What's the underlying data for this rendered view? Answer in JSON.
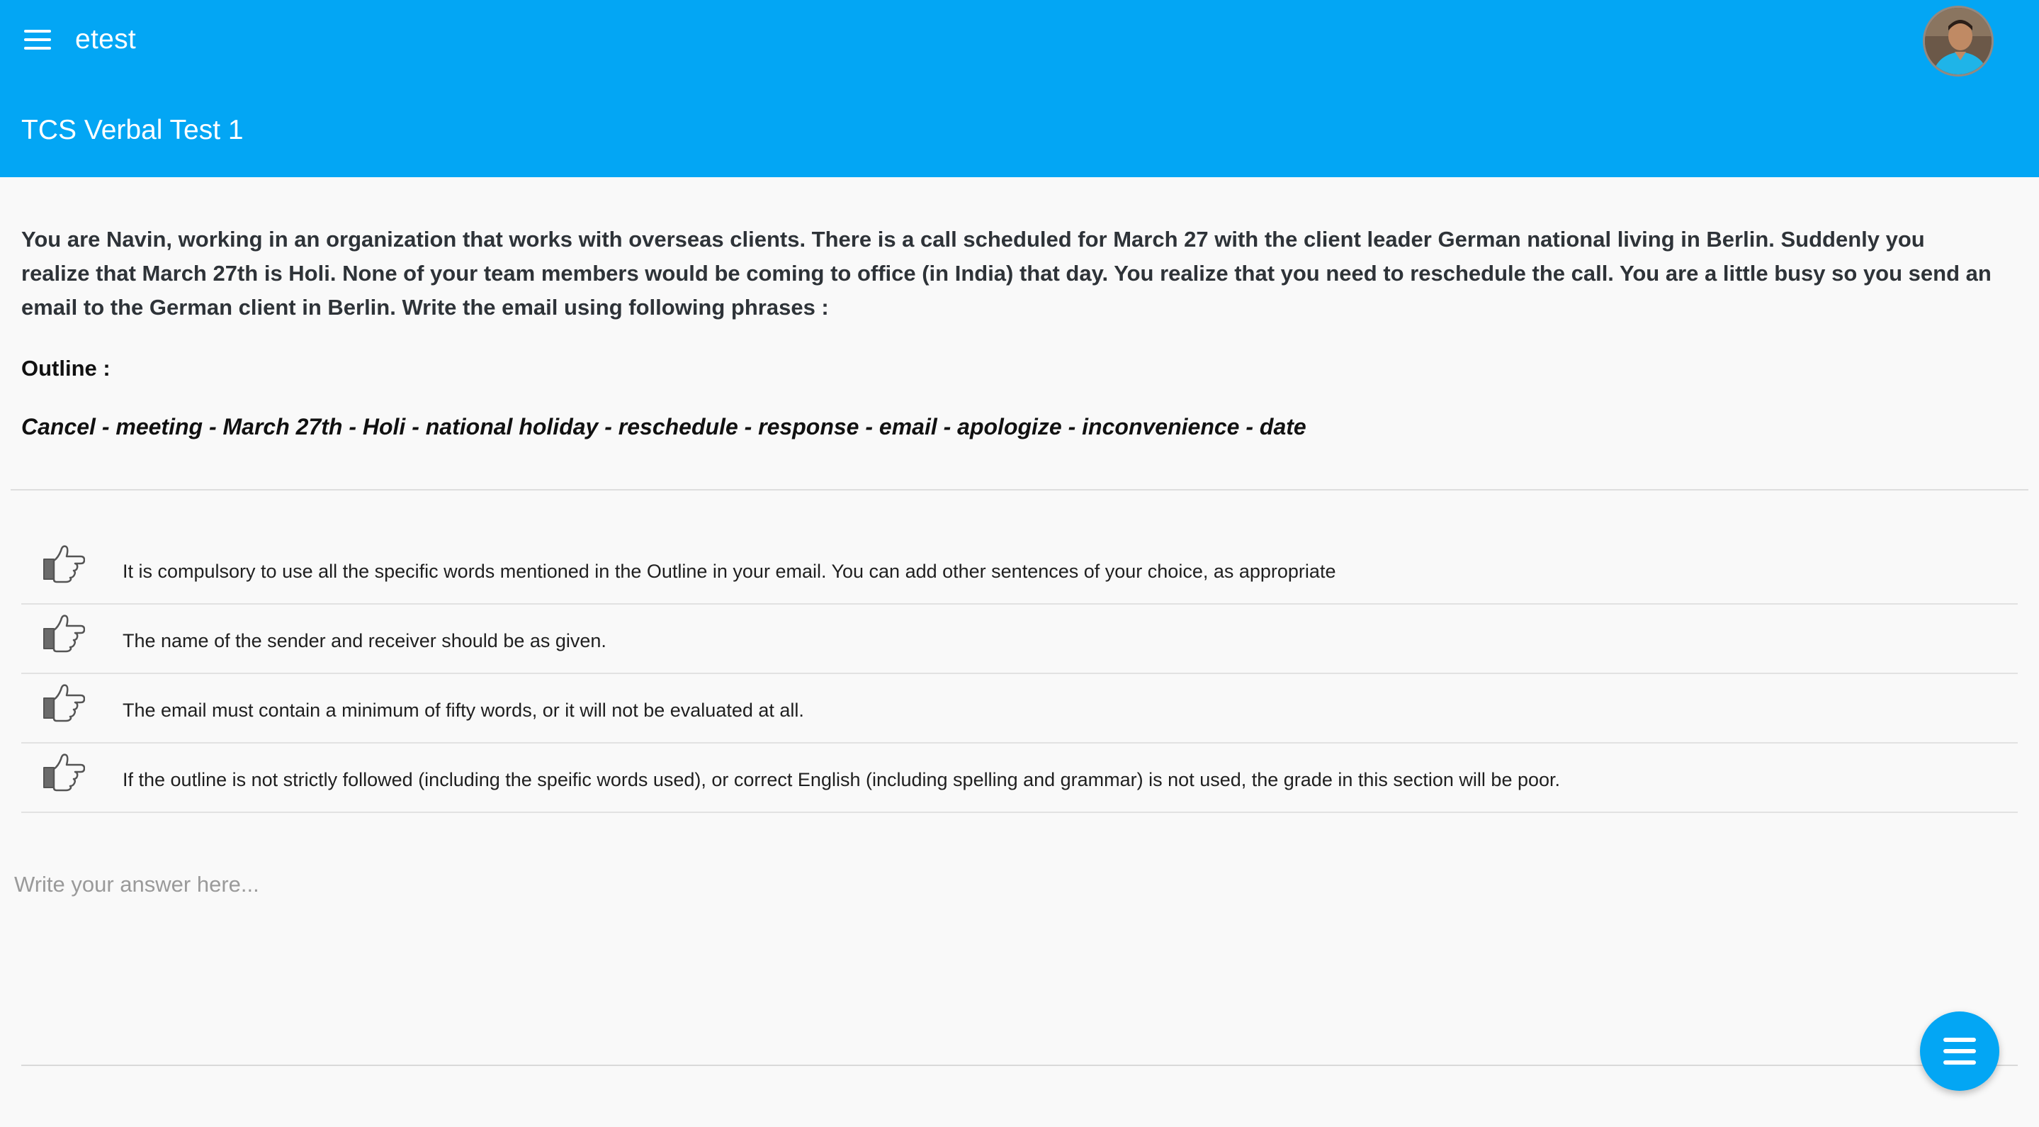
{
  "appbar": {
    "app_name": "etest",
    "test_title": "TCS Verbal Test 1",
    "menu_icon": "hamburger-menu-icon",
    "color": "#03a6f4"
  },
  "question": {
    "prompt": "You are Navin, working in an organization that works with overseas clients. There is a call scheduled for March 27 with the client leader German national living in Berlin. Suddenly you realize that March 27th is Holi. None of your team members would be coming to office (in India) that day. You realize that you need to reschedule the call. You are a little busy so you send an email to the German client in Berlin. Write the email using following phrases :",
    "outline_label": "Outline :",
    "outline_words": "Cancel - meeting - March 27th - Holi - national holiday - reschedule - response - email - apologize - inconvenience - date"
  },
  "rules": [
    {
      "icon": "thumbs-pointing-right-icon",
      "text": "It is compulsory to use all the specific words mentioned in the Outline in your email. You can add other sentences of your choice, as appropriate"
    },
    {
      "icon": "thumbs-pointing-right-icon",
      "text": "The name of the sender and receiver should be as given."
    },
    {
      "icon": "thumbs-pointing-right-icon",
      "text": "The email must contain a minimum of fifty words, or it will not be evaluated at all."
    },
    {
      "icon": "thumbs-pointing-right-icon",
      "text": "If the outline is not strictly followed (including the speific words used), or correct English (including spelling and grammar) is not used, the grade in this section will be poor."
    }
  ],
  "answer": {
    "placeholder": "Write your answer here...",
    "value": ""
  },
  "fab": {
    "icon": "menu-lines-icon"
  }
}
